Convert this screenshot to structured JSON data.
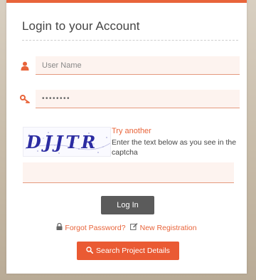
{
  "login": {
    "title": "Login to your Account",
    "username_placeholder": "User Name",
    "password_value": "••••••••",
    "captcha_text": "DJJTR",
    "try_another": "Try another",
    "captcha_hint": "Enter the text below as you see in the captcha",
    "captcha_value": "",
    "login_button": "Log In",
    "forgot_password": "Forgot Password?",
    "new_registration": "New Registration",
    "search_button": "Search Project Details"
  },
  "icons": {
    "user": "user-icon",
    "key": "key-icon",
    "lock": "lock-icon",
    "edit": "edit-icon",
    "search": "search-icon"
  },
  "colors": {
    "accent": "#e8643a",
    "button_dark": "#5b5b5b",
    "search_button": "#ea5a33",
    "field_bg": "#fdf3ef"
  }
}
